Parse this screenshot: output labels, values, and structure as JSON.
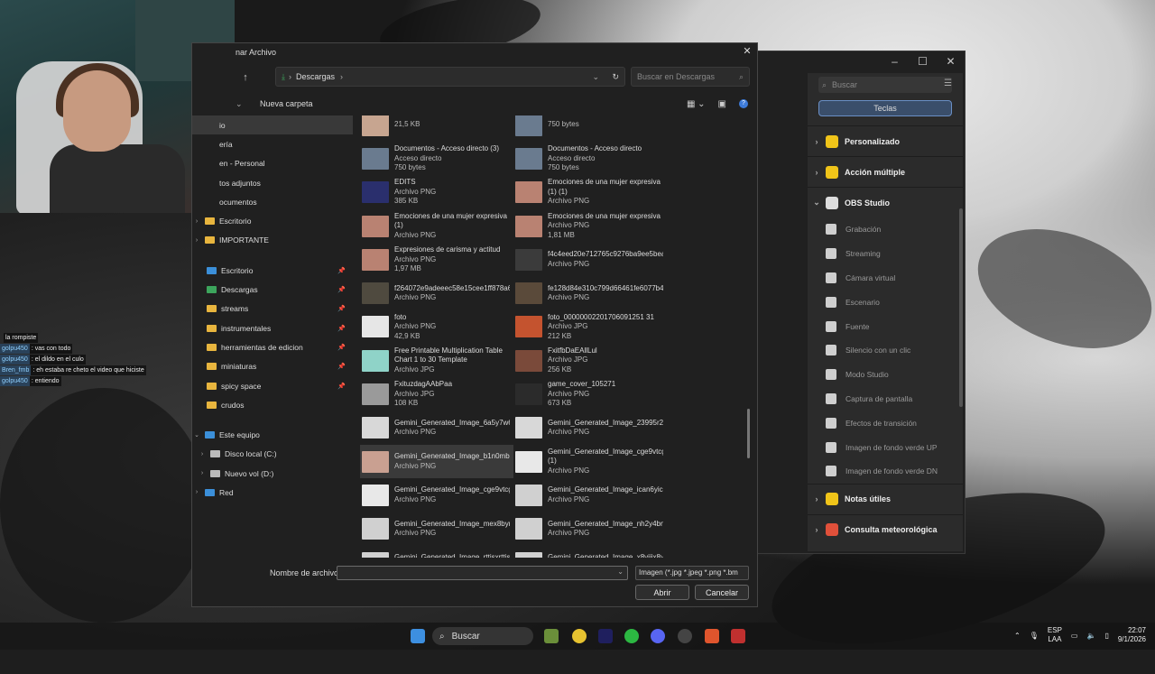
{
  "dialog": {
    "title": "nar Archivo",
    "close": "✕",
    "path_current": "Descargas",
    "search_placeholder": "Buscar en Descargas",
    "new_folder": "Nueva carpeta",
    "filename_label": "Nombre de archivo:",
    "filename_value": "",
    "filetype_value": "Imagen (*.jpg *.jpeg *.png *.bm",
    "open_button": "Abrir",
    "cancel_button": "Cancelar"
  },
  "nav": {
    "items": [
      {
        "label": "io",
        "type": "folder-hidden",
        "selected": true
      },
      {
        "label": "ería",
        "type": "plain"
      },
      {
        "label": "en - Personal",
        "type": "plain"
      },
      {
        "label": "tos adjuntos",
        "type": "plain"
      },
      {
        "label": "ocumentos",
        "type": "plain"
      },
      {
        "label": "Escritorio",
        "type": "folder",
        "expander": "›"
      },
      {
        "label": "IMPORTANTE",
        "type": "folder",
        "expander": "›"
      }
    ],
    "quick": [
      {
        "label": "Escritorio",
        "icon": "desktop-icon",
        "pin": true
      },
      {
        "label": "Descargas",
        "icon": "download-icon",
        "pin": true
      },
      {
        "label": "streams",
        "icon": "folder-icon",
        "pin": true
      },
      {
        "label": "instrumentales",
        "icon": "folder-icon",
        "pin": true
      },
      {
        "label": "herramientas de edicion",
        "icon": "folder-icon",
        "pin": true
      },
      {
        "label": "miniaturas",
        "icon": "folder-icon",
        "pin": true
      },
      {
        "label": "spicy space",
        "icon": "folder-icon",
        "pin": true
      },
      {
        "label": "crudos",
        "icon": "folder-icon",
        "pin": false
      }
    ],
    "pc": [
      {
        "label": "Este equipo",
        "expander": "⌄"
      },
      {
        "label": "Disco local (C:)",
        "expander": "›"
      },
      {
        "label": "Nuevo vol (D:)",
        "expander": "›"
      },
      {
        "label": "Red",
        "expander": "›"
      }
    ]
  },
  "files": [
    {
      "name": "",
      "line2": "21,5 KB",
      "line3": "",
      "thumb": "#c7a590"
    },
    {
      "name": "",
      "line2": "750 bytes",
      "line3": "",
      "thumb": "#6a7b8f"
    },
    {
      "name": "Documentos - Acceso directo (3)",
      "line2": "Acceso directo",
      "line3": "750 bytes",
      "thumb": "#6a7b8f"
    },
    {
      "name": "Documentos - Acceso directo",
      "line2": "Acceso directo",
      "line3": "750 bytes",
      "thumb": "#6a7b8f"
    },
    {
      "name": "EDITS",
      "line2": "Archivo PNG",
      "line3": "385 KB",
      "thumb": "#2a2f6d"
    },
    {
      "name": "Emociones de una mujer expresiva (1) (1)",
      "line2": "Archivo PNG",
      "line3": "",
      "thumb": "#b98272"
    },
    {
      "name": "Emociones de una mujer expresiva (1)",
      "line2": "Archivo PNG",
      "line3": "",
      "thumb": "#b98272"
    },
    {
      "name": "Emociones de una mujer expresiva",
      "line2": "Archivo PNG",
      "line3": "1,81 MB",
      "thumb": "#b98272"
    },
    {
      "name": "Expresiones de carisma y actitud",
      "line2": "Archivo PNG",
      "line3": "1,97 MB",
      "thumb": "#b98272"
    },
    {
      "name": "f4c4eed20e712765c9276ba9ee5bea76",
      "line2": "Archivo PNG",
      "line3": "",
      "thumb": "#3b3b3b"
    },
    {
      "name": "f264072e9adeeec58e15cee1ff878a6a.466x466x1",
      "line2": "Archivo PNG",
      "line3": "",
      "thumb": "#4f4a3f"
    },
    {
      "name": "fe128d84e310c799d66461fe6077b43c.1000x1000x1",
      "line2": "Archivo PNG",
      "line3": "",
      "thumb": "#5a4a3a"
    },
    {
      "name": "foto",
      "line2": "Archivo PNG",
      "line3": "42,9 KB",
      "thumb": "#e6e6e6"
    },
    {
      "name": "foto_00000002201706091251 31",
      "line2": "Archivo JPG",
      "line3": "212 KB",
      "thumb": "#c4532f"
    },
    {
      "name": "Free Printable Multiplication Table Chart 1 to 30 Template",
      "line2": "Archivo JPG",
      "line3": "",
      "thumb": "#8fd3c8"
    },
    {
      "name": "FxitfbDaEAllLul",
      "line2": "Archivo JPG",
      "line3": "256 KB",
      "thumb": "#7a4a3a"
    },
    {
      "name": "FxituzdagAAbPaa",
      "line2": "Archivo JPG",
      "line3": "108 KB",
      "thumb": "#9a9a9a"
    },
    {
      "name": "game_cover_105271",
      "line2": "Archivo PNG",
      "line3": "673 KB",
      "thumb": "#2b2b2b"
    },
    {
      "name": "Gemini_Generated_Image_6a5y7w6a5y7w6a5y",
      "line2": "Archivo PNG",
      "line3": "",
      "thumb": "#d8d8d8"
    },
    {
      "name": "Gemini_Generated_Image_23995r2392r2399",
      "line2": "Archivo PNG",
      "line3": "",
      "thumb": "#d8d8d8"
    },
    {
      "name": "Gemini_Generated_Image_b1n0mb1n0mb1n0",
      "line2": "Archivo PNG",
      "line3": "",
      "thumb": "#c9a091",
      "hover": true
    },
    {
      "name": "Gemini_Generated_Image_cge9vtcge9vtcge9 (1)",
      "line2": "Archivo PNG",
      "line3": "",
      "thumb": "#e8e8e8"
    },
    {
      "name": "Gemini_Generated_Image_cge9vtcge9vtcge9",
      "line2": "Archivo PNG",
      "line3": "",
      "thumb": "#e8e8e8"
    },
    {
      "name": "Gemini_Generated_Image_ican6yican6yican",
      "line2": "Archivo PNG",
      "line3": "",
      "thumb": "#d0d0d0"
    },
    {
      "name": "Gemini_Generated_Image_mex8bymex8bymex8",
      "line2": "Archivo PNG",
      "line3": "",
      "thumb": "#d0d0d0"
    },
    {
      "name": "Gemini_Generated_Image_nh2y4bnh2y4bnh2y",
      "line2": "Archivo PNG",
      "line3": "",
      "thumb": "#d0d0d0"
    },
    {
      "name": "Gemini_Generated_Image_rttjsxrttjsxrttj",
      "line2": "Archivo PNG",
      "line3": "",
      "thumb": "#d0d0d0"
    },
    {
      "name": "Gemini_Generated_Image_x8yijix8yijix8yi",
      "line2": "Archivo PNG",
      "line3": "",
      "thumb": "#d0d0d0"
    }
  ],
  "panel": {
    "search_placeholder": "Buscar",
    "tab": "Teclas",
    "categories_top": [
      {
        "label": "Personalizado",
        "color": "#f0c419"
      },
      {
        "label": "Acción múltiple",
        "color": "#f0c419"
      },
      {
        "label": "OBS Studio",
        "color": "#dddddd",
        "expanded": true
      }
    ],
    "obs_items": [
      "Grabación",
      "Streaming",
      "Cámara virtual",
      "Escenario",
      "Fuente",
      "Silencio con un clic",
      "Modo Studio",
      "Captura de pantalla",
      "Efectos de transición",
      "Imagen de fondo verde UP",
      "Imagen de fondo verde DN"
    ],
    "categories_bottom": [
      {
        "label": "Notas útiles",
        "color": "#f0c419"
      },
      {
        "label": "Consulta meteorológica",
        "color": "#e0503a"
      }
    ]
  },
  "chat": [
    {
      "user": "",
      "msg": "la rompiste"
    },
    {
      "user": "golpu450",
      "msg": ": vas con todo"
    },
    {
      "user": "golpu450",
      "msg": ": el dildo en el culo"
    },
    {
      "user": "Bren_fmb",
      "msg": ": eh estaba re cheto el video que hiciste"
    },
    {
      "user": "golpu450",
      "msg": ": entiendo"
    }
  ],
  "taskbar": {
    "search": "Buscar",
    "lang1": "ESP",
    "lang2": "LAA",
    "time": "22:07",
    "date": "9/1/2026"
  }
}
